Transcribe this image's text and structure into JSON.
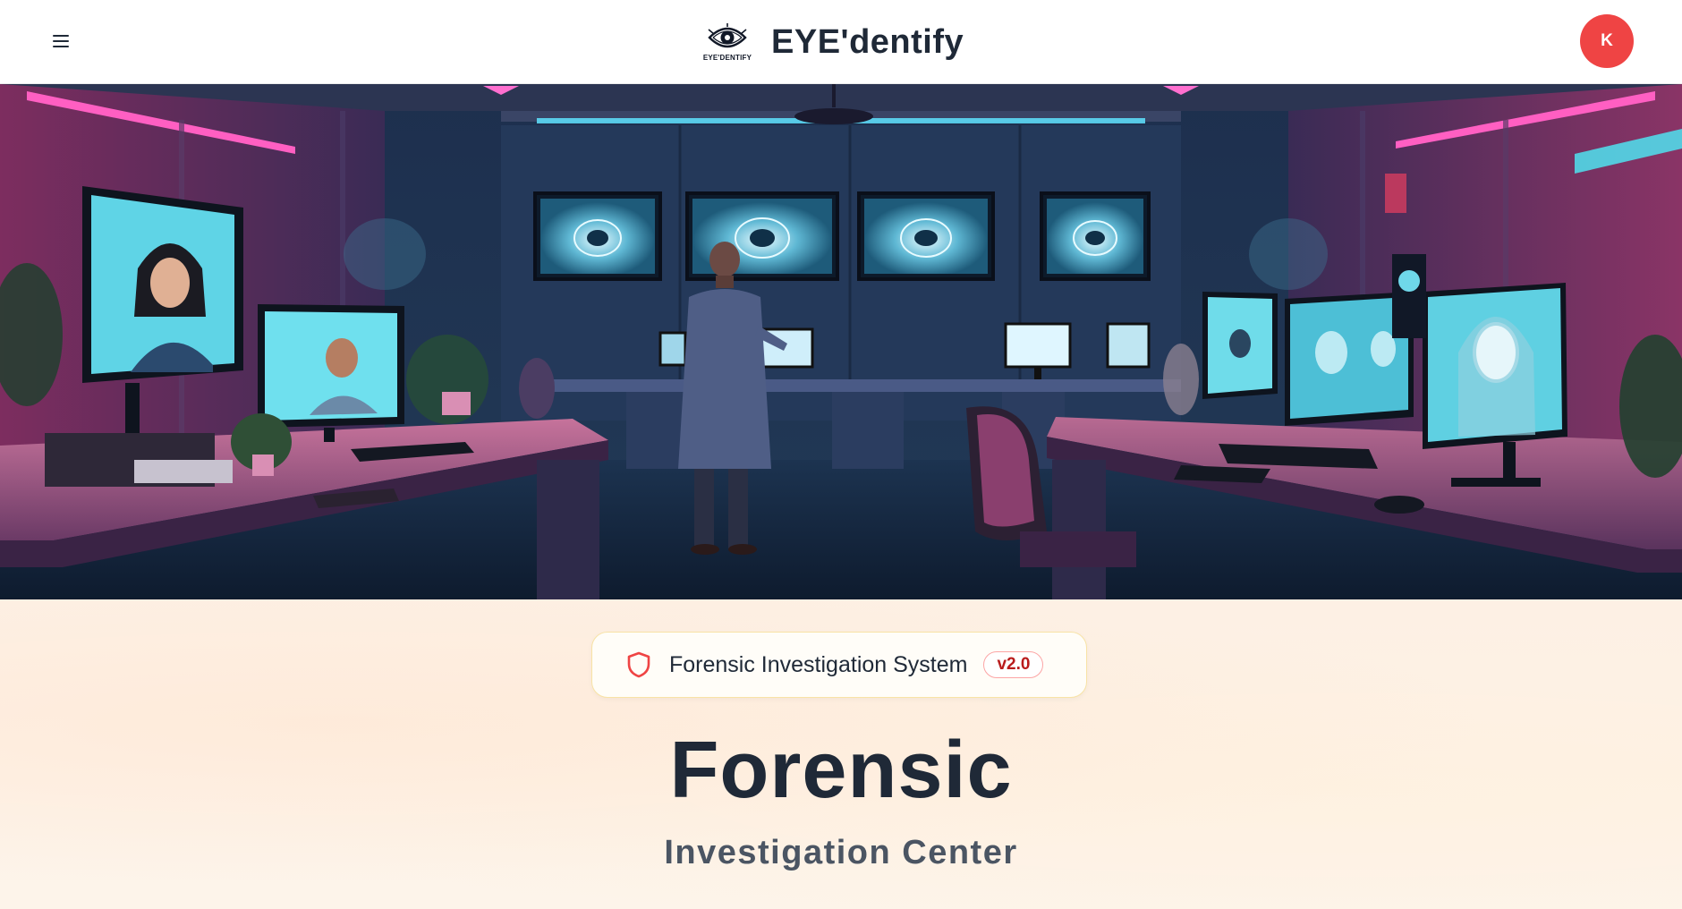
{
  "header": {
    "brand_name": "EYE'dentify",
    "logo_text": "EYE'DENTIFY",
    "avatar_initial": "K"
  },
  "hero": {
    "image": "forensic-lab-illustration"
  },
  "badge": {
    "icon": "shield-icon",
    "label": "Forensic Investigation System",
    "version": "v2.0"
  },
  "main": {
    "title": "Forensic",
    "subtitle": "Investigation Center"
  },
  "colors": {
    "avatar": "#ef4444",
    "title": "#1f2937",
    "subtitle": "#4b5563",
    "badge_border": "#f8e3a6",
    "version_text": "#b91c1c",
    "background": "#fdf3e6"
  }
}
